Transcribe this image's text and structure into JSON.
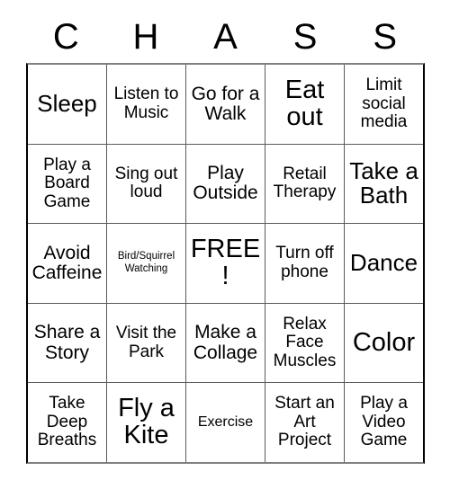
{
  "card": {
    "title": "Bingo Card",
    "header_letters": [
      "C",
      "H",
      "A",
      "S",
      "S"
    ],
    "columns": 5,
    "rows": 5,
    "free_space_label": "FREE!",
    "colors": {
      "background": "#ffffff",
      "text": "#000000",
      "grid_line": "#5a5a5a",
      "outer_border": "#000000"
    },
    "cells": [
      [
        {
          "text": "Sleep",
          "size": "xl"
        },
        {
          "text": "Listen to Music",
          "size": "md"
        },
        {
          "text": "Go for a Walk",
          "size": "lg"
        },
        {
          "text": "Eat out",
          "size": "xxl"
        },
        {
          "text": "Limit social media",
          "size": "md"
        }
      ],
      [
        {
          "text": "Play a Board Game",
          "size": "md"
        },
        {
          "text": "Sing out loud",
          "size": "md"
        },
        {
          "text": "Play Outside",
          "size": "lg"
        },
        {
          "text": "Retail Therapy",
          "size": "md"
        },
        {
          "text": "Take a Bath",
          "size": "xl"
        }
      ],
      [
        {
          "text": "Avoid Caffeine",
          "size": "lg"
        },
        {
          "text": "Bird/Squirrel Watching",
          "size": "xs"
        },
        {
          "text": "FREE!",
          "size": "xxl"
        },
        {
          "text": "Turn off phone",
          "size": "md"
        },
        {
          "text": "Dance",
          "size": "xl"
        }
      ],
      [
        {
          "text": "Share a Story",
          "size": "lg"
        },
        {
          "text": "Visit the Park",
          "size": "md"
        },
        {
          "text": "Make a Collage",
          "size": "lg"
        },
        {
          "text": "Relax Face Muscles",
          "size": "md"
        },
        {
          "text": "Color",
          "size": "xxl"
        }
      ],
      [
        {
          "text": "Take Deep Breaths",
          "size": "md"
        },
        {
          "text": "Fly a Kite",
          "size": "xxl"
        },
        {
          "text": "Exercise",
          "size": "sm"
        },
        {
          "text": "Start an Art Project",
          "size": "md"
        },
        {
          "text": "Play a Video Game",
          "size": "md"
        }
      ]
    ]
  }
}
